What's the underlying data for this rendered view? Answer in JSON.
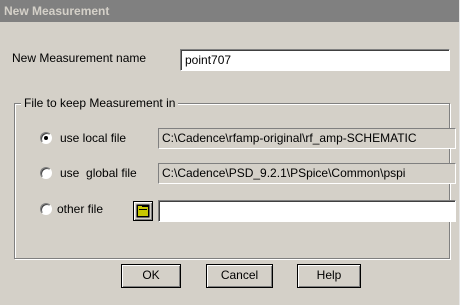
{
  "window": {
    "title": "New Measurement"
  },
  "name_field": {
    "label": "New Measurement name",
    "value": "point707"
  },
  "file_group": {
    "legend": "File to keep Measurement in",
    "options": [
      {
        "label": "use local file",
        "path": "C:\\Cadence\\rfamp-original\\rf_amp-SCHEMATIC",
        "selected": true
      },
      {
        "label": "use  global file",
        "path": "C:\\Cadence\\PSD_9.2.1\\PSpice\\Common\\pspi",
        "selected": false
      },
      {
        "label": "other file",
        "path": "",
        "selected": false
      }
    ]
  },
  "buttons": {
    "ok": "OK",
    "cancel": "Cancel",
    "help": "Help"
  },
  "colors": {
    "dialog_bg": "#d4d0c8",
    "titlebar_bg": "#808080",
    "titlebar_text": "#d4d0c8"
  },
  "icons": {
    "browse": "folder-icon"
  }
}
